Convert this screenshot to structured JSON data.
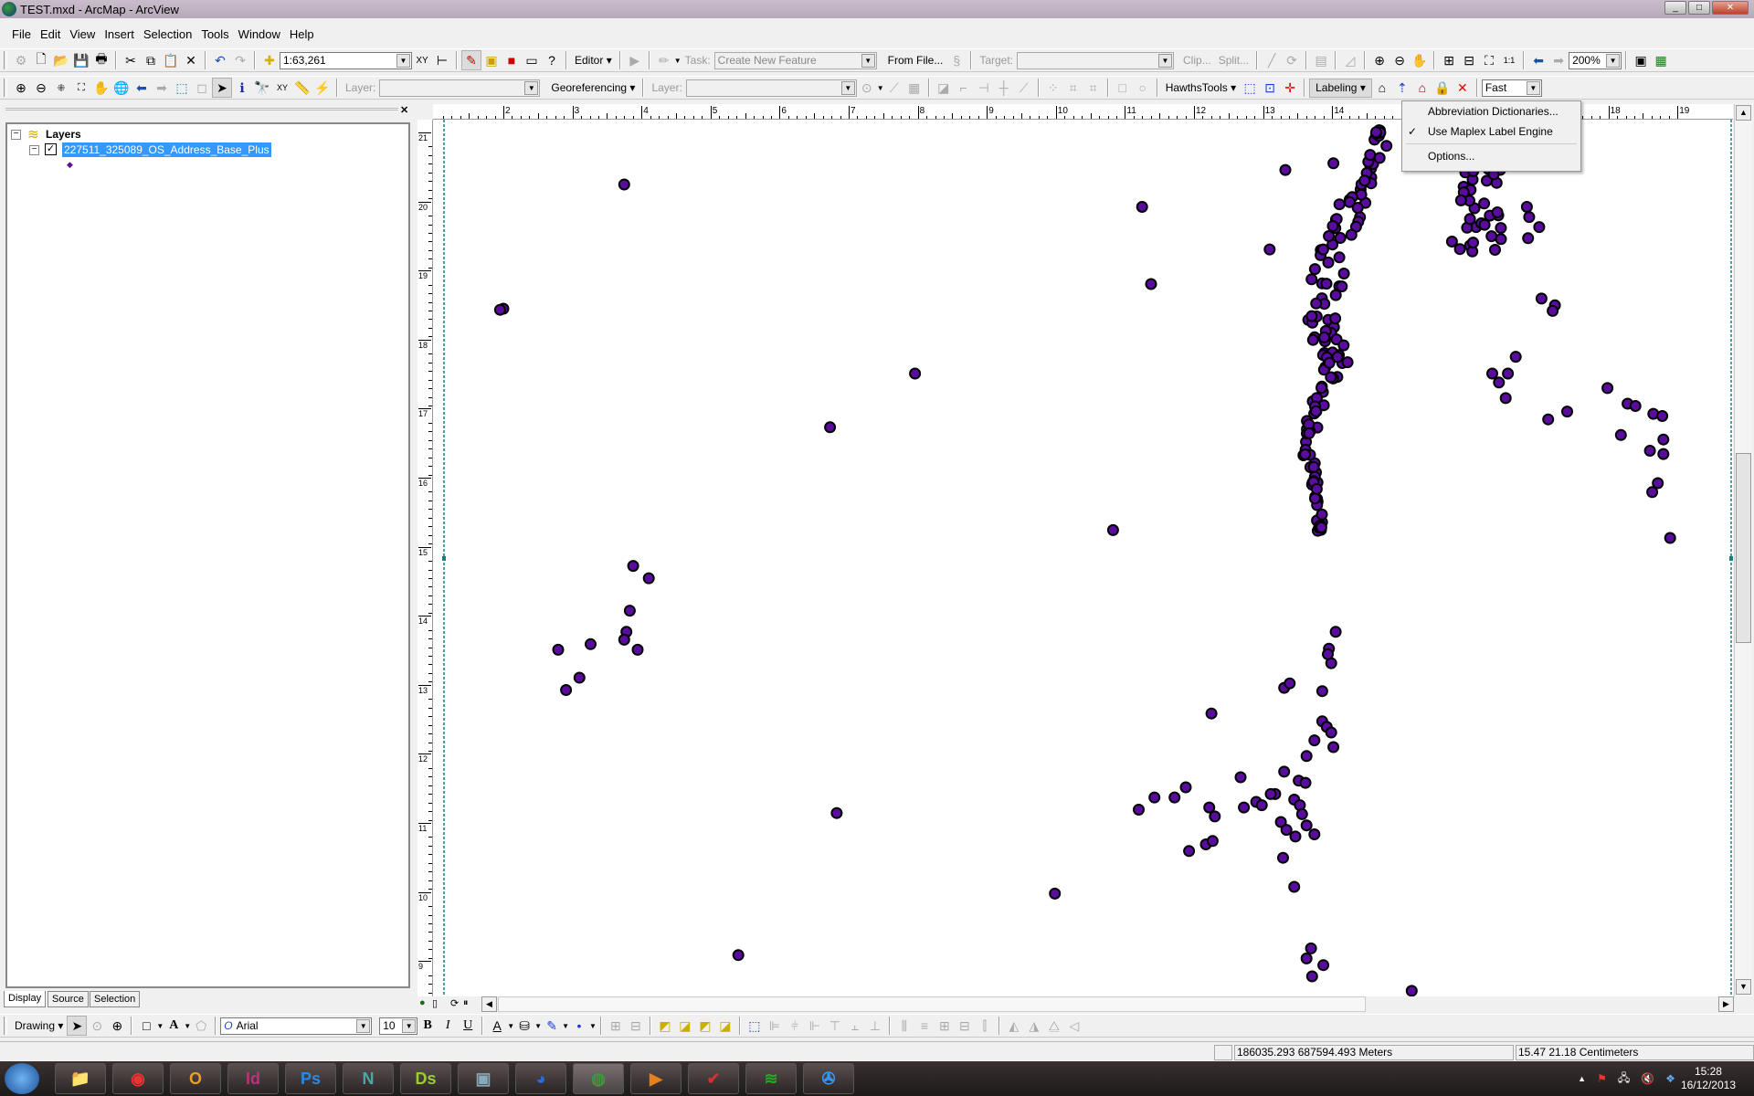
{
  "window": {
    "title": "TEST.mxd - ArcMap - ArcView"
  },
  "menu": [
    "File",
    "Edit",
    "View",
    "Insert",
    "Selection",
    "Tools",
    "Window",
    "Help"
  ],
  "standard_toolbar": {
    "scale": "1:63,261",
    "editor": "Editor",
    "task_label": "Task:",
    "task_value": "Create New Feature",
    "from_file": "From File...",
    "target_label": "Target:",
    "target_value": "",
    "clip": "Clip...",
    "split": "Split...",
    "zoom_percent": "200%"
  },
  "tools_toolbar": {
    "layer_label": "Layer:",
    "layer_value": "",
    "georef": "Georeferencing",
    "georef_layer_label": "Layer:",
    "georef_layer_value": "",
    "hawths": "HawthsTools",
    "labeling": "Labeling",
    "label_quality": "Fast"
  },
  "labeling_menu": {
    "items": [
      "Abbreviation Dictionaries...",
      "Use Maplex Label Engine",
      "Options..."
    ],
    "checked": "Use Maplex Label Engine"
  },
  "toc": {
    "root": "Layers",
    "layer": "227511_325089_OS_Address_Base_Plus",
    "layer_checked": true,
    "symbol_color": "#5a0c9e",
    "tabs": [
      "Display",
      "Source",
      "Selection"
    ]
  },
  "map": {
    "ruler_x": [
      "2",
      "3",
      "4",
      "5",
      "6",
      "7",
      "8",
      "9",
      "10",
      "11",
      "12",
      "13",
      "14",
      "15",
      "16",
      "17",
      "18",
      "19"
    ],
    "ruler_y": [
      "21",
      "20",
      "19",
      "18",
      "17",
      "16",
      "15",
      "14",
      "13",
      "12",
      "11",
      "10",
      "9"
    ],
    "point_fill": "#5a0c9e",
    "point_stroke": "#000000"
  },
  "drawing_toolbar": {
    "drawing": "Drawing",
    "font": "Arial",
    "size": "10",
    "bold": "B",
    "italic": "I",
    "underline": "U"
  },
  "status": {
    "map_coords": "186035.293  687594.493 Meters",
    "page_coords": "15.47  21.18 Centimeters"
  },
  "taskbar": {
    "apps": [
      "windows-explorer",
      "chrome",
      "outlook",
      "indesign",
      "photoshop",
      "3ds-max",
      "ds-app",
      "photo-viewer",
      "google-earth",
      "arcmap",
      "media-player",
      "app-checklist",
      "app-green",
      "app-wind"
    ],
    "time": "15:28",
    "date": "16/12/2013"
  }
}
